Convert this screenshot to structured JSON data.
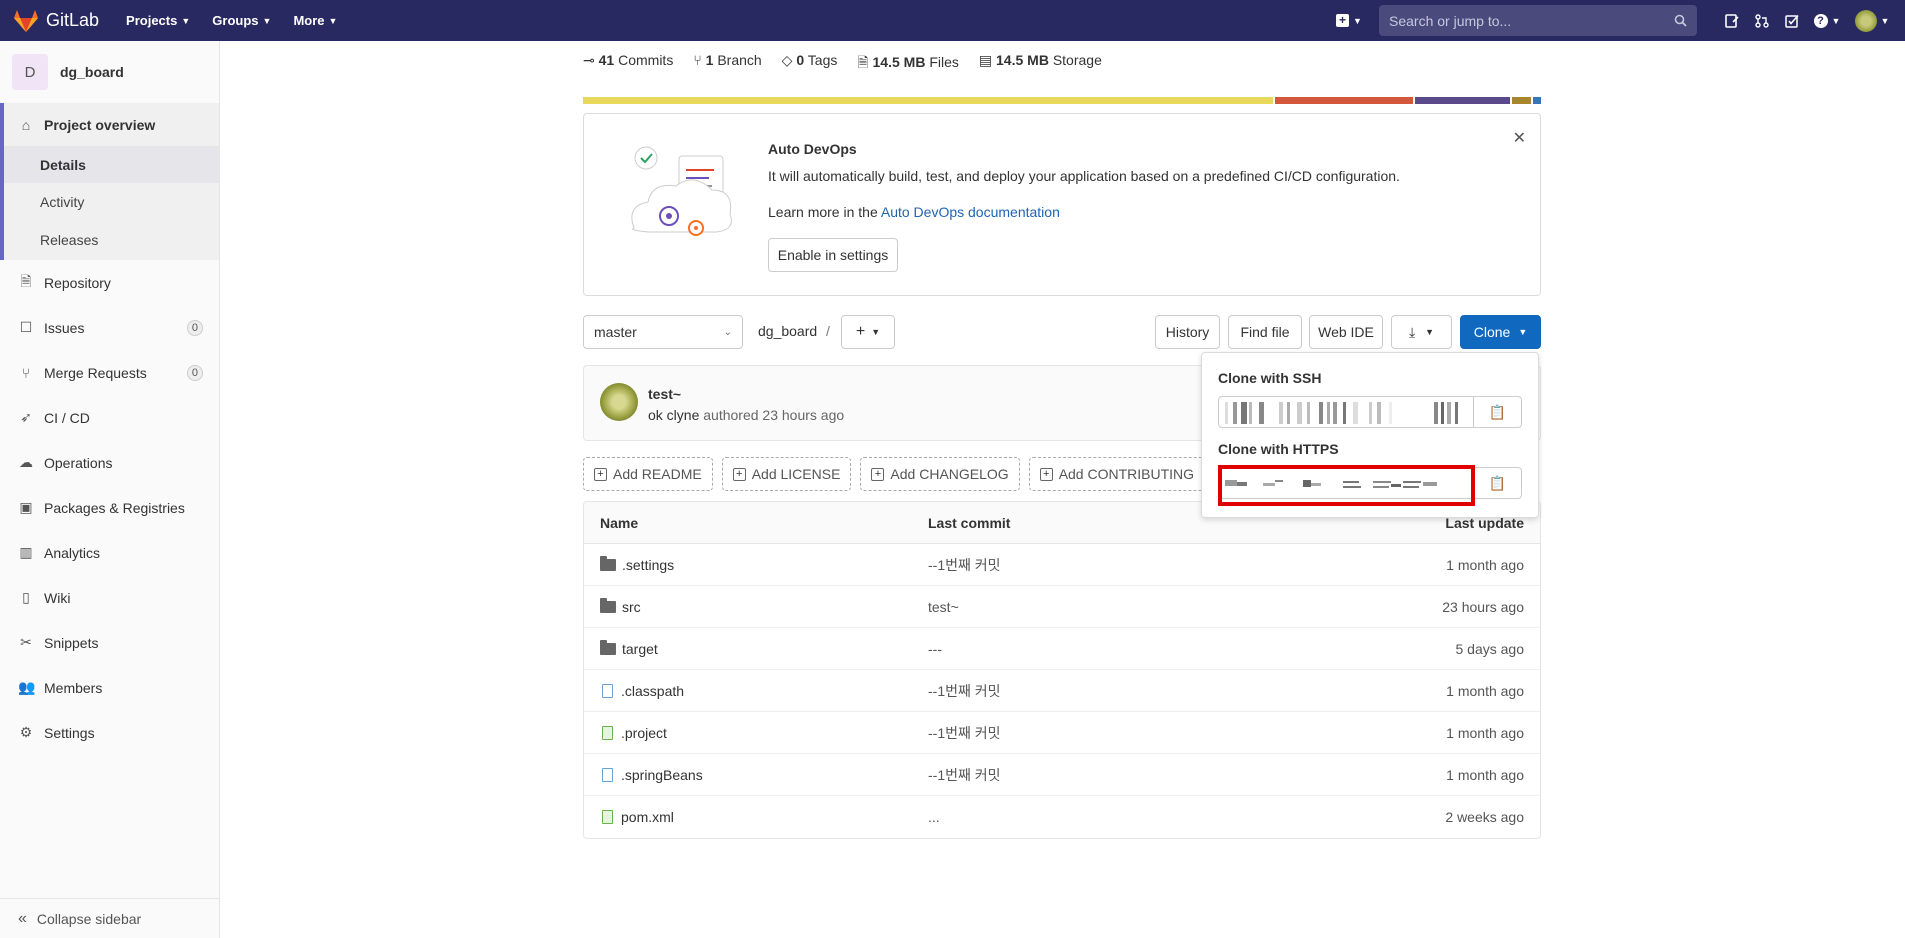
{
  "navbar": {
    "brand": "GitLab",
    "links": [
      {
        "label": "Projects"
      },
      {
        "label": "Groups"
      },
      {
        "label": "More"
      }
    ],
    "search_placeholder": "Search or jump to...",
    "icons": [
      "plus-icon",
      "search-icon",
      "issues-icon",
      "merge-request-icon",
      "todo-icon",
      "help-icon",
      "user-avatar"
    ]
  },
  "sidebar": {
    "project_initial": "D",
    "project_name": "dg_board",
    "overview": {
      "label": "Project overview",
      "sub": [
        {
          "label": "Details",
          "active": true
        },
        {
          "label": "Activity"
        },
        {
          "label": "Releases"
        }
      ]
    },
    "items": [
      {
        "label": "Repository",
        "icon": "file-icon"
      },
      {
        "label": "Issues",
        "icon": "issues-icon",
        "badge": "0"
      },
      {
        "label": "Merge Requests",
        "icon": "merge-request-icon",
        "badge": "0"
      },
      {
        "label": "CI / CD",
        "icon": "rocket-icon"
      },
      {
        "label": "Operations",
        "icon": "cloud-icon"
      },
      {
        "label": "Packages & Registries",
        "icon": "package-icon"
      },
      {
        "label": "Analytics",
        "icon": "chart-icon"
      },
      {
        "label": "Wiki",
        "icon": "book-icon"
      },
      {
        "label": "Snippets",
        "icon": "scissors-icon"
      },
      {
        "label": "Members",
        "icon": "users-icon"
      },
      {
        "label": "Settings",
        "icon": "gear-icon"
      }
    ],
    "collapse": "Collapse sidebar"
  },
  "stats": {
    "commits_count": "41",
    "commits_label": "Commits",
    "branch_count": "1",
    "branch_label": "Branch",
    "tags_count": "0",
    "tags_label": "Tags",
    "files_size": "14.5 MB",
    "files_label": "Files",
    "storage_size": "14.5 MB",
    "storage_label": "Storage"
  },
  "language_bar_colors": [
    "#e8d85b",
    "#d3573a",
    "#5b4b8a",
    "#a8862e",
    "#3b73b9"
  ],
  "devops": {
    "title": "Auto DevOps",
    "description": "It will automatically build, test, and deploy your application based on a predefined CI/CD configuration.",
    "learn_prefix": "Learn more in the",
    "learn_link": "Auto DevOps documentation",
    "button": "Enable in settings"
  },
  "toolbar": {
    "branch": "master",
    "breadcrumb": "dg_board",
    "separator": "/",
    "history": "History",
    "find_file": "Find file",
    "web_ide": "Web IDE",
    "clone": "Clone"
  },
  "last_commit": {
    "title": "test~",
    "author": "ok clyne",
    "authored": "authored 23 hours ago"
  },
  "add_buttons": [
    "Add README",
    "Add LICENSE",
    "Add CHANGELOG",
    "Add CONTRIBUTING"
  ],
  "table": {
    "headers": {
      "name": "Name",
      "last_commit": "Last commit",
      "last_update": "Last update"
    },
    "rows": [
      {
        "name": ".settings",
        "type": "folder",
        "commit": "--1번째 커밋",
        "date": "1 month ago"
      },
      {
        "name": "src",
        "type": "folder",
        "commit": "test~",
        "date": "23 hours ago"
      },
      {
        "name": "target",
        "type": "folder",
        "commit": "---",
        "date": "5 days ago"
      },
      {
        "name": ".classpath",
        "type": "file",
        "commit": "--1번째 커밋",
        "date": "1 month ago"
      },
      {
        "name": ".project",
        "type": "file-green",
        "commit": "--1번째 커밋",
        "date": "1 month ago"
      },
      {
        "name": ".springBeans",
        "type": "file",
        "commit": "--1번째 커밋",
        "date": "1 month ago"
      },
      {
        "name": "pom.xml",
        "type": "file-green",
        "commit": "...",
        "date": "2 weeks ago"
      }
    ]
  },
  "clone_dropdown": {
    "ssh_label": "Clone with SSH",
    "https_label": "Clone with HTTPS"
  },
  "colors": {
    "navbar": "#292961",
    "accent": "#6666c4",
    "link": "#1f64b3",
    "clone_button": "#1068bf",
    "highlight": "#e00000"
  }
}
